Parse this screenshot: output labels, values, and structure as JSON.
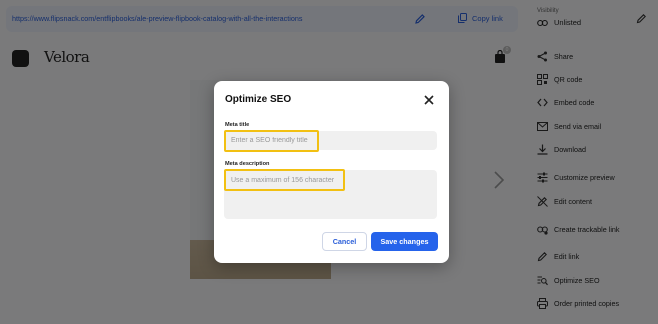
{
  "linkbar": {
    "url": "https://www.flipsnack.com/entflipbooks/ale-preview-flipbook-catalog-with-all-the-interactions",
    "copy_label": "Copy link"
  },
  "viewer": {
    "brand": "Velora",
    "cart_count": "0"
  },
  "sidebar": {
    "visibility_label": "Visibility",
    "visibility_value": "Unlisted",
    "items": [
      {
        "label": "Share",
        "icon": "share-icon"
      },
      {
        "label": "QR code",
        "icon": "qr-code-icon"
      },
      {
        "label": "Embed code",
        "icon": "embed-code-icon"
      },
      {
        "label": "Send via email",
        "icon": "email-icon"
      },
      {
        "label": "Download",
        "icon": "download-icon"
      },
      {
        "label": "Customize preview",
        "icon": "sliders-icon"
      },
      {
        "label": "Edit content",
        "icon": "edit-content-icon"
      },
      {
        "label": "Create trackable link",
        "icon": "trackable-link-icon"
      },
      {
        "label": "Edit link",
        "icon": "pencil-icon"
      },
      {
        "label": "Optimize SEO",
        "icon": "seo-icon"
      },
      {
        "label": "Order printed copies",
        "icon": "printer-icon"
      }
    ]
  },
  "modal": {
    "title": "Optimize SEO",
    "meta_title_label": "Meta title",
    "meta_title_placeholder": "Enter a SEO friendly title",
    "meta_title_value": "",
    "meta_description_label": "Meta description",
    "meta_description_placeholder": "Use a maximum of 156 character",
    "meta_description_value": "",
    "cancel_label": "Cancel",
    "save_label": "Save changes"
  },
  "colors": {
    "accent": "#2563eb",
    "highlight": "#f2c012",
    "link": "#2b5fd9"
  }
}
